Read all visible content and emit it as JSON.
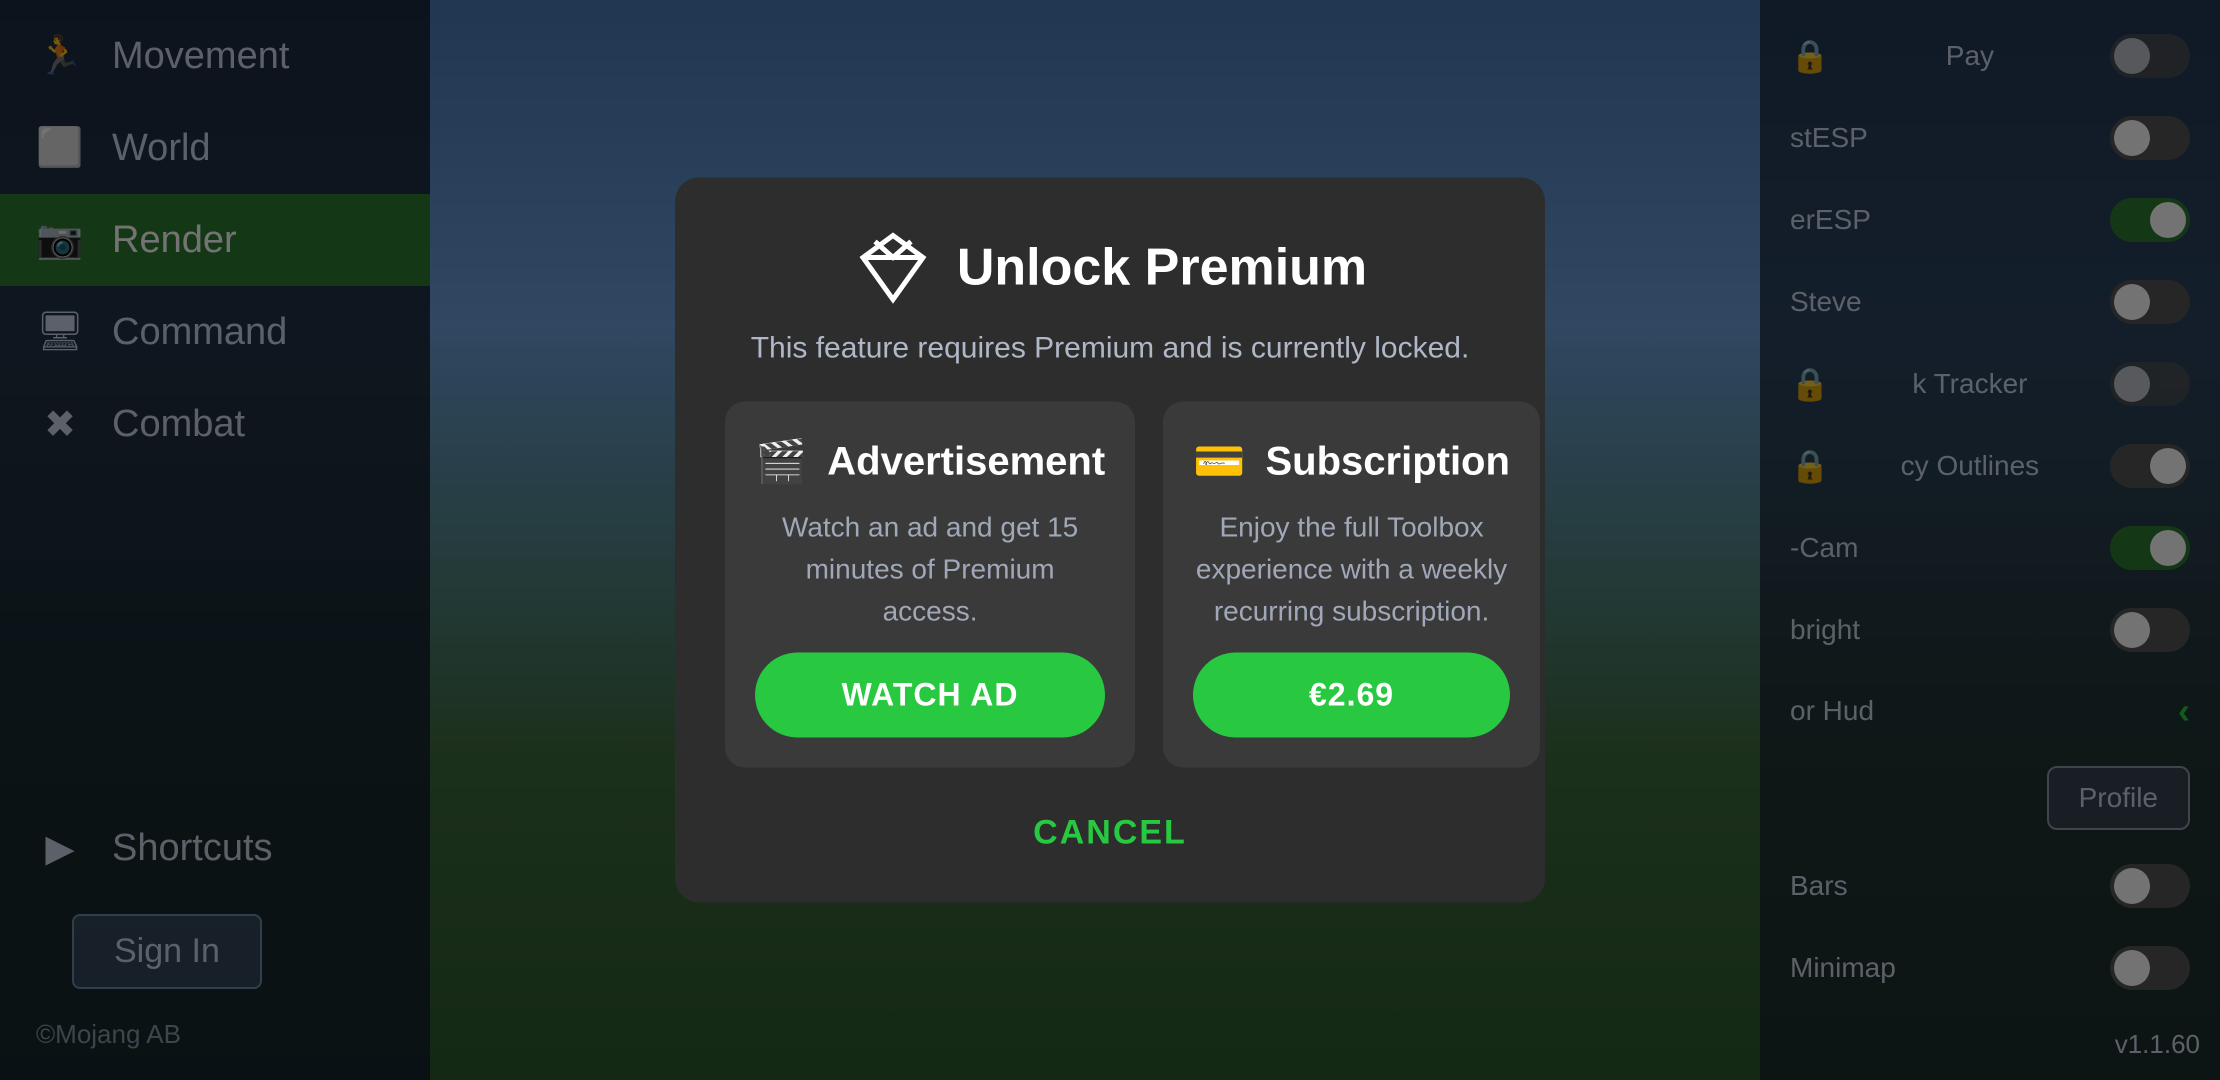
{
  "sidebar": {
    "items": [
      {
        "id": "movement",
        "label": "Movement",
        "icon": "🏃",
        "active": false
      },
      {
        "id": "world",
        "label": "World",
        "icon": "⬜",
        "active": false
      },
      {
        "id": "render",
        "label": "Render",
        "icon": "📷",
        "active": true
      },
      {
        "id": "command",
        "label": "Command",
        "icon": "🖥",
        "active": false
      },
      {
        "id": "combat",
        "label": "Combat",
        "icon": "✖",
        "active": false
      },
      {
        "id": "shortcuts",
        "label": "Shortcuts",
        "icon": "▶",
        "active": false
      }
    ],
    "sign_in_label": "Sign In",
    "copyright": "©Mojang AB"
  },
  "right_panel": {
    "items": [
      {
        "label": "Pay",
        "toggle": "off",
        "locked": true
      },
      {
        "label": "stESP",
        "toggle": "off",
        "locked": false
      },
      {
        "label": "erESP",
        "toggle": "on",
        "locked": false
      },
      {
        "label": "Steve",
        "toggle": "off",
        "locked": false
      },
      {
        "label": "k Tracker",
        "toggle": "off",
        "locked": true
      },
      {
        "label": "cy Outlines",
        "toggle": "off",
        "locked": true
      },
      {
        "label": "-Cam",
        "toggle": "on",
        "locked": false
      },
      {
        "label": "bright",
        "toggle": "off",
        "locked": false
      },
      {
        "label": "or Hud",
        "toggle": "on",
        "locked": false
      },
      {
        "label": "Bars",
        "toggle": "off",
        "locked": false
      },
      {
        "label": "Minimap",
        "toggle": "off",
        "locked": false
      }
    ],
    "profile_label": "Profile",
    "version": "v1.1.60"
  },
  "dialog": {
    "title": "Unlock Premium",
    "subtitle": "This feature requires Premium and is currently locked.",
    "advertisement": {
      "title": "Advertisement",
      "description": "Watch an ad and get 15 minutes of Premium access.",
      "button_label": "WATCH AD"
    },
    "subscription": {
      "title": "Subscription",
      "description": "Enjoy the full Toolbox experience with a weekly recurring subscription.",
      "button_label": "€2.69"
    },
    "cancel_label": "CANCEL"
  }
}
